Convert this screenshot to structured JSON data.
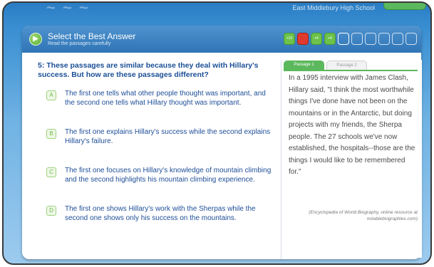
{
  "top": {
    "logo": "~ ~ ~",
    "school": "East Middlebury High School"
  },
  "header": {
    "title": "Select the Best Answer",
    "subtitle": "Read the passages carefully",
    "progress": [
      {
        "label": "+10",
        "state": "correct"
      },
      {
        "label": "",
        "state": "wrong"
      },
      {
        "label": "+4",
        "state": "correct"
      },
      {
        "label": "+4",
        "state": "correct"
      },
      {
        "label": "",
        "state": "current"
      },
      {
        "label": "",
        "state": "pending"
      },
      {
        "label": "",
        "state": "pending"
      },
      {
        "label": "",
        "state": "pending"
      },
      {
        "label": "",
        "state": "pending"
      },
      {
        "label": "",
        "state": "pending"
      }
    ]
  },
  "question": {
    "text": "5: These passages are similar because they deal with Hillary's success. But how are these passages different?"
  },
  "answers": [
    {
      "letter": "A",
      "text": "The first one tells what other people thought was important, and the second one tells what Hillary thought was important."
    },
    {
      "letter": "B",
      "text": "The first one explains Hillary's success while the second explains Hillary's failure."
    },
    {
      "letter": "C",
      "text": "The first one focuses on Hillary's knowledge of mountain climbing and the second highlights his mountain climbing experience."
    },
    {
      "letter": "D",
      "text": "The first one shows Hillary's work with the Sherpas while the second one shows only his success on the mountains."
    }
  ],
  "passage": {
    "tab_1": "Passage 1",
    "tab_2": "Passage 2",
    "text": "In a 1995 interview with James Clash, Hillary said, \"I think the most worthwhile things I've done have not been on the mountains or in the Antarctic, but doing projects with my friends, the Sherpa people. The 27 schools we've now established, the hospitals--those are the things I would like to be remembered for.\"",
    "citation": "(Encyclopedia of World Biography, online resource at notablebiographies.com)"
  },
  "colors": {
    "accent_green": "#5cb85c",
    "wrong_red": "#e03a2e",
    "question_blue": "#1a4f96"
  }
}
